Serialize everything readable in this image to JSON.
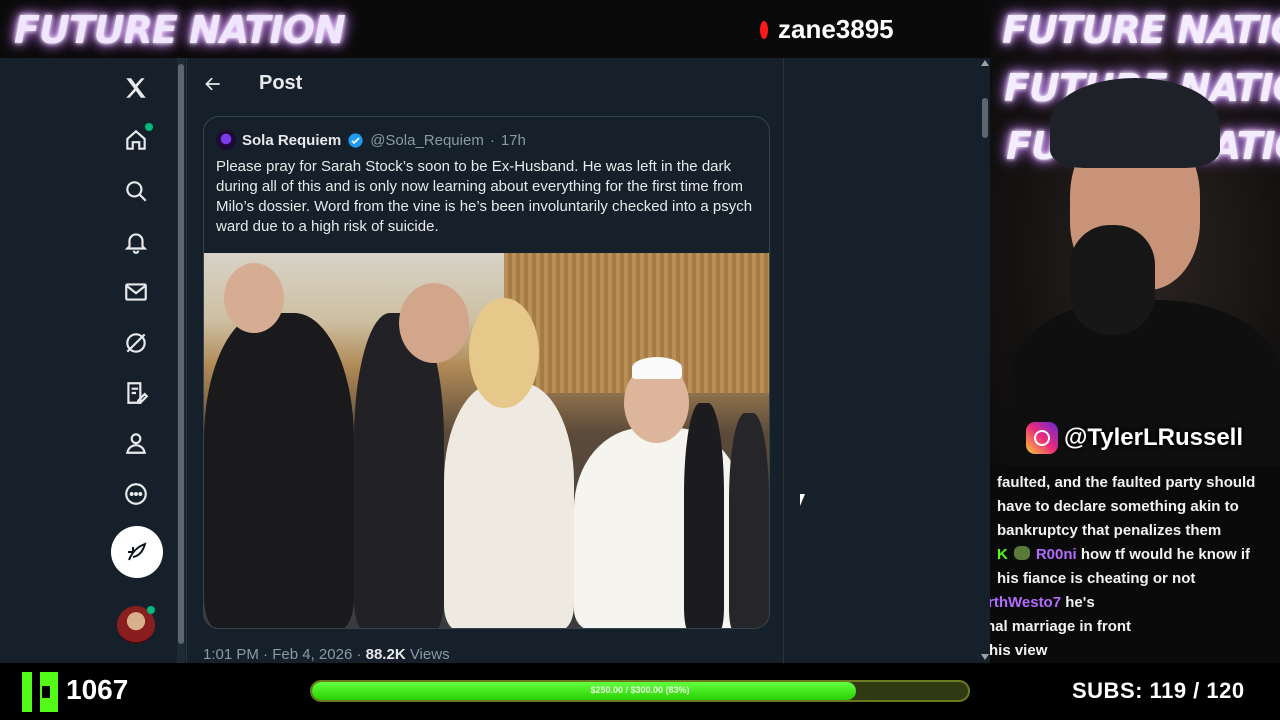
{
  "overlay": {
    "brand": "FUTURE NATION",
    "stream_handle": "zane3895",
    "instagram_handle": "@TylerLRussell",
    "kick_count": "1067",
    "goal_text": "$250.00 / $300.00 (83%)",
    "goal_progress": 0.83,
    "subs_text": "SUBS:  119 / 120",
    "accent_green": "#53fc18"
  },
  "sidebar": {
    "items": [
      {
        "icon": "x-logo-icon"
      },
      {
        "icon": "home-icon"
      },
      {
        "icon": "search-icon"
      },
      {
        "icon": "bell-icon"
      },
      {
        "icon": "mail-icon"
      },
      {
        "icon": "grok-icon"
      },
      {
        "icon": "notes-icon"
      },
      {
        "icon": "profile-icon"
      },
      {
        "icon": "more-icon"
      }
    ],
    "post_button_icon": "compose-icon"
  },
  "post": {
    "header_title": "Post",
    "quote": {
      "name": "Sola Requiem",
      "handle": "@Sola_Requiem",
      "separator": "·",
      "time": "17h",
      "text": "Please pray for Sarah Stock’s soon to be Ex-Husband. He was left in the dark during all of this and is only now learning about everything for the first time from Milo’s dossier. Word from the vine is he’s been involuntarily checked into a psych ward due to a high risk of suicide."
    },
    "meta": {
      "time": "1:01 PM",
      "date": "Feb 4, 2026",
      "views_count": "88.2K",
      "views_label": "Views",
      "separator": "·"
    }
  },
  "chat": {
    "lines": [
      {
        "user": "",
        "text": "faulted, and the faulted party should"
      },
      {
        "user": "",
        "text": "have to declare something akin to"
      },
      {
        "user": "",
        "text": "bankruptcy that penalizes them"
      },
      {
        "user": "R00ni",
        "text": "how tf would he know if"
      },
      {
        "user": "",
        "text": "his fiance is cheating or not"
      },
      {
        "user": "rthWesto7",
        "text": "he's"
      },
      {
        "user": "",
        "text": "nal marriage in front"
      },
      {
        "user": "",
        "text": "his view"
      }
    ]
  }
}
